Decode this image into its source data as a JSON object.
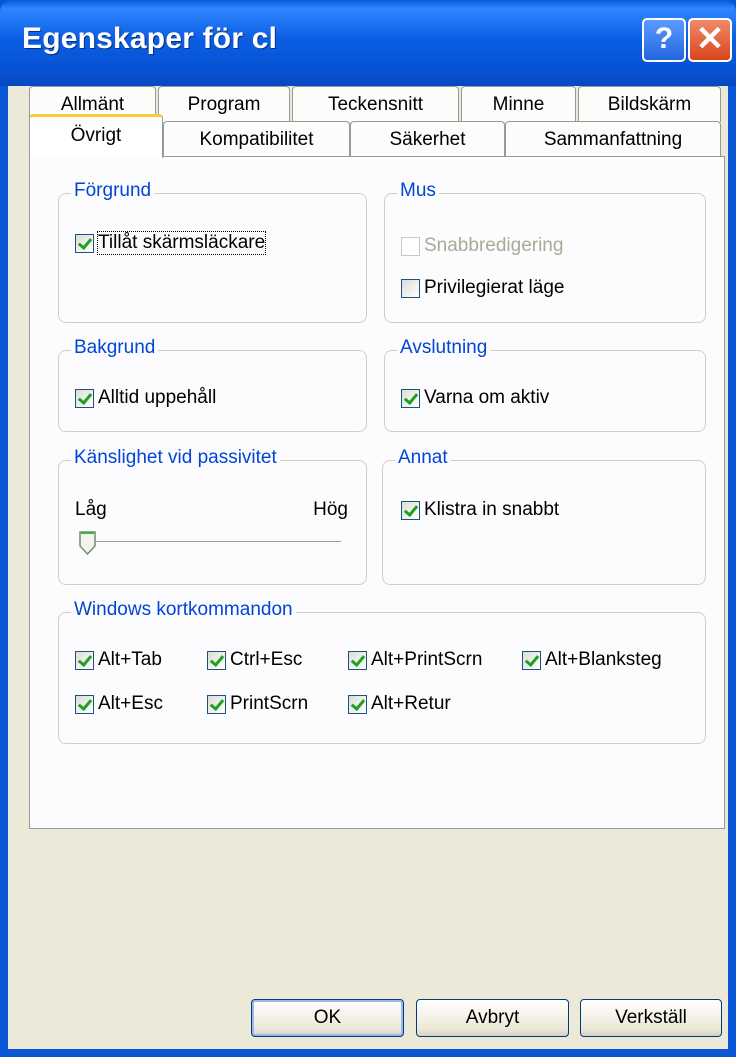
{
  "window": {
    "title": "Egenskaper för cl",
    "help_label": "?",
    "close_label": "✕"
  },
  "tabs": {
    "row1": [
      "Allmänt",
      "Program",
      "Teckensnitt",
      "Minne",
      "Bildskärm"
    ],
    "row2": [
      "Övrigt",
      "Kompatibilitet",
      "Säkerhet",
      "Sammanfattning"
    ],
    "active": "Övrigt"
  },
  "groups": {
    "forgrund": {
      "title": "Förgrund",
      "options": [
        {
          "label": "Tillåt skärmsläckare",
          "checked": true
        }
      ]
    },
    "mus": {
      "title": "Mus",
      "options": [
        {
          "label": "Snabbredigering",
          "checked": false,
          "disabled": true
        },
        {
          "label": "Privilegierat läge",
          "checked": false
        }
      ]
    },
    "bakgrund": {
      "title": "Bakgrund",
      "options": [
        {
          "label": "Alltid uppehåll",
          "checked": true
        }
      ]
    },
    "avslutning": {
      "title": "Avslutning",
      "options": [
        {
          "label": "Varna om aktiv",
          "checked": true
        }
      ]
    },
    "kanslighet": {
      "title": "Känslighet vid passivitet",
      "low_label": "Låg",
      "high_label": "Hög",
      "slider_value": 0
    },
    "annat": {
      "title": "Annat",
      "options": [
        {
          "label": "Klistra in snabbt",
          "checked": true
        }
      ]
    },
    "kortkommandon": {
      "title": "Windows kortkommandon",
      "options": [
        {
          "label": "Alt+Tab",
          "checked": true
        },
        {
          "label": "Ctrl+Esc",
          "checked": true
        },
        {
          "label": "Alt+PrintScrn",
          "checked": true
        },
        {
          "label": "Alt+Blanksteg",
          "checked": true
        },
        {
          "label": "Alt+Esc",
          "checked": true
        },
        {
          "label": "PrintScrn",
          "checked": true
        },
        {
          "label": "Alt+Retur",
          "checked": true
        }
      ]
    }
  },
  "buttons": {
    "ok": "OK",
    "cancel": "Avbryt",
    "apply": "Verkställ"
  },
  "colors": {
    "titlebar": "#0a5ad9",
    "accent_tab": "#ffc83c",
    "group_title": "#0046d5",
    "check": "#21a121"
  }
}
